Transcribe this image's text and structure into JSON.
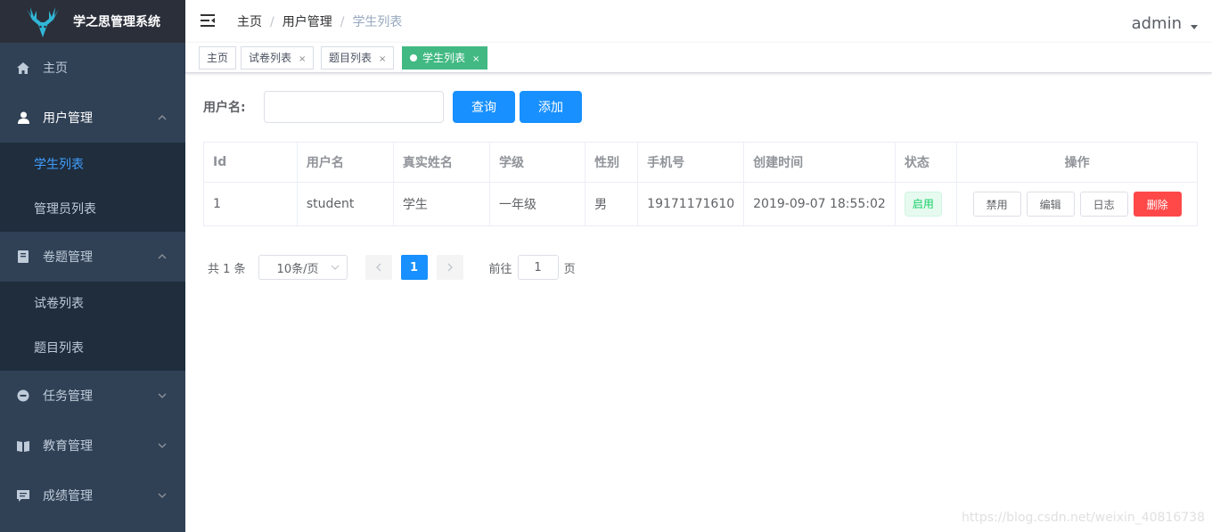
{
  "app": {
    "title": "学之思管理系统"
  },
  "sidebar": {
    "home": "主页",
    "user_mgmt": {
      "label": "用户管理",
      "items": [
        "学生列表",
        "管理员列表"
      ]
    },
    "exam_mgmt": {
      "label": "卷题管理",
      "items": [
        "试卷列表",
        "题目列表"
      ]
    },
    "task_mgmt": "任务管理",
    "edu_mgmt": "教育管理",
    "score_mgmt": "成绩管理"
  },
  "breadcrumb": [
    "主页",
    "用户管理",
    "学生列表"
  ],
  "breadcrumb_sep": "/",
  "user": {
    "name": "admin"
  },
  "tags": [
    {
      "label": "主页"
    },
    {
      "label": "试卷列表",
      "close": "×"
    },
    {
      "label": "题目列表",
      "close": "×"
    },
    {
      "label": "学生列表",
      "close": "×",
      "active": true
    }
  ],
  "filter": {
    "label": "用户名:",
    "value": "",
    "search_btn": "查询",
    "add_btn": "添加"
  },
  "table": {
    "headers": [
      "Id",
      "用户名",
      "真实姓名",
      "学级",
      "性别",
      "手机号",
      "创建时间",
      "状态",
      "操作"
    ],
    "rows": [
      {
        "id": "1",
        "username": "student",
        "realname": "学生",
        "grade": "一年级",
        "gender": "男",
        "phone": "19171171610",
        "created": "2019-09-07 18:55:02",
        "status": "启用"
      }
    ],
    "actions": [
      "禁用",
      "编辑",
      "日志",
      "删除"
    ]
  },
  "pagination": {
    "total": "共 1 条",
    "page_size": "10条/页",
    "current": "1",
    "goto_label": "前往",
    "goto_value": "1",
    "page_suffix": "页"
  },
  "watermark": "https://blog.csdn.net/weixin_40816738",
  "colors": {
    "sidebar": "#304156",
    "submenu": "#1f2d3d",
    "primary": "#1890ff",
    "active_tag": "#42b983",
    "danger": "#ff4949",
    "active_link": "#409eff"
  }
}
